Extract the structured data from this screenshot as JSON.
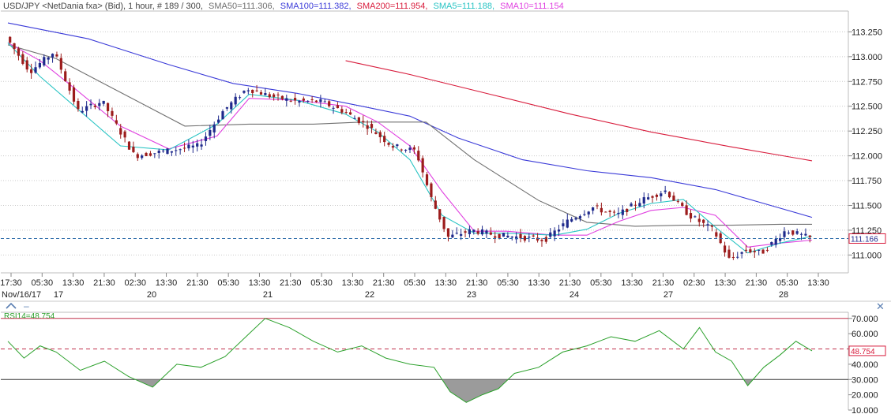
{
  "header": {
    "symbol": "USD/JPY <NetDania fxa> (Bid), 1 hour, # 189 / 300,",
    "sma50": "SMA50=111.306,",
    "sma100": "SMA100=111.382,",
    "sma200": "SMA200=111.954,",
    "sma5": "SMA5=111.188,",
    "sma10": "SMA10=111.154"
  },
  "colors": {
    "sma50": "#707070",
    "sma100": "#3a3ad8",
    "sma200": "#d81c3c",
    "sma5": "#29c4c4",
    "sma10": "#e040e0",
    "bull": "#1f2a8c",
    "bear": "#9c1c1c",
    "rsi": "#2aa02a",
    "grid": "#c9c9c9"
  },
  "price_axis": {
    "ticks": [
      "113.250",
      "113.000",
      "112.750",
      "112.500",
      "112.250",
      "112.000",
      "111.750",
      "111.500",
      "111.250",
      "111.000"
    ],
    "last_price_label": "111.166"
  },
  "time_axis": {
    "times": [
      "17:30",
      "05:30",
      "13:30",
      "21:30",
      "02:30",
      "13:30",
      "21:30",
      "05:30",
      "13:30",
      "21:30",
      "05:30",
      "13:30",
      "21:30",
      "05:30",
      "13:30",
      "21:30",
      "05:30",
      "13:30",
      "21:30",
      "05:30",
      "13:30",
      "21:30",
      "02:30",
      "13:30",
      "21:30",
      "05:30",
      "13:30"
    ],
    "dates": [
      "Nov/16/17",
      "17",
      "20",
      "21",
      "22",
      "23",
      "24",
      "27",
      "28"
    ]
  },
  "rsi": {
    "label": "RSI14=48.754",
    "value_label": "48.754",
    "ticks": [
      "70.000",
      "60.000",
      "50.000",
      "40.000",
      "30.000",
      "20.000",
      "10.000"
    ]
  },
  "chart_data": [
    {
      "type": "candlestick",
      "title": "USD/JPY <NetDania fxa> (Bid), 1 hour",
      "ylim": [
        110.82,
        113.46
      ],
      "last_price": 111.166,
      "series": [
        {
          "name": "SMA200",
          "value": 111.954,
          "x": [
            0.42,
            0.5,
            0.6,
            0.7,
            0.8,
            0.9,
            1.0
          ],
          "values": [
            112.96,
            112.82,
            112.62,
            112.42,
            112.24,
            112.09,
            111.95
          ]
        },
        {
          "name": "SMA100",
          "value": 111.382,
          "x": [
            0.0,
            0.1,
            0.2,
            0.28,
            0.36,
            0.44,
            0.5,
            0.56,
            0.64,
            0.72,
            0.8,
            0.88,
            0.94,
            1.0
          ],
          "values": [
            113.34,
            113.18,
            112.92,
            112.73,
            112.63,
            112.5,
            112.4,
            112.18,
            111.96,
            111.85,
            111.78,
            111.66,
            111.52,
            111.38
          ]
        },
        {
          "name": "SMA50",
          "value": 111.306,
          "x": [
            0.0,
            0.06,
            0.14,
            0.22,
            0.3,
            0.38,
            0.44,
            0.52,
            0.58,
            0.66,
            0.72,
            0.78,
            0.84,
            0.9,
            0.96,
            1.0
          ],
          "values": [
            113.12,
            112.98,
            112.64,
            112.3,
            112.32,
            112.32,
            112.34,
            112.34,
            111.96,
            111.55,
            111.33,
            111.29,
            111.3,
            111.3,
            111.31,
            111.31
          ]
        },
        {
          "name": "SMA10",
          "value": 111.154,
          "x": [
            0.0,
            0.04,
            0.08,
            0.14,
            0.2,
            0.26,
            0.3,
            0.36,
            0.42,
            0.46,
            0.5,
            0.54,
            0.58,
            0.62,
            0.68,
            0.72,
            0.76,
            0.8,
            0.84,
            0.88,
            0.92,
            0.96,
            1.0
          ],
          "values": [
            113.14,
            112.96,
            112.7,
            112.3,
            112.07,
            112.2,
            112.58,
            112.56,
            112.5,
            112.34,
            112.1,
            111.64,
            111.24,
            111.24,
            111.2,
            111.2,
            111.34,
            111.45,
            111.48,
            111.4,
            111.08,
            111.12,
            111.15
          ]
        },
        {
          "name": "SMA5",
          "value": 111.188,
          "x": [
            0.0,
            0.04,
            0.08,
            0.14,
            0.2,
            0.26,
            0.3,
            0.36,
            0.42,
            0.46,
            0.5,
            0.54,
            0.58,
            0.62,
            0.68,
            0.72,
            0.76,
            0.8,
            0.84,
            0.88,
            0.92,
            0.96,
            1.0
          ],
          "values": [
            113.14,
            112.8,
            112.52,
            112.1,
            112.06,
            112.32,
            112.62,
            112.56,
            112.42,
            112.24,
            111.96,
            111.4,
            111.22,
            111.22,
            111.2,
            111.26,
            111.42,
            111.52,
            111.56,
            111.28,
            111.02,
            111.12,
            111.19
          ]
        },
        {
          "name": "Price",
          "x": [
            0.0,
            0.03,
            0.06,
            0.09,
            0.12,
            0.16,
            0.2,
            0.24,
            0.27,
            0.3,
            0.33,
            0.36,
            0.39,
            0.42,
            0.45,
            0.48,
            0.51,
            0.53,
            0.55,
            0.58,
            0.61,
            0.64,
            0.67,
            0.7,
            0.73,
            0.76,
            0.79,
            0.82,
            0.85,
            0.88,
            0.9,
            0.92,
            0.94,
            0.97,
            1.0
          ],
          "values": [
            113.2,
            112.85,
            113.05,
            112.45,
            112.55,
            112.0,
            112.05,
            112.1,
            112.45,
            112.68,
            112.6,
            112.55,
            112.55,
            112.45,
            112.3,
            112.1,
            112.05,
            111.55,
            111.18,
            111.25,
            111.2,
            111.18,
            111.15,
            111.35,
            111.48,
            111.4,
            111.55,
            111.65,
            111.4,
            111.25,
            110.95,
            111.05,
            111.02,
            111.25,
            111.17
          ]
        }
      ]
    },
    {
      "type": "line",
      "title": "RSI14",
      "ylim": [
        10,
        74
      ],
      "levels": [
        70,
        50,
        30
      ],
      "x": [
        0.0,
        0.02,
        0.04,
        0.06,
        0.09,
        0.12,
        0.15,
        0.18,
        0.21,
        0.24,
        0.27,
        0.3,
        0.32,
        0.35,
        0.38,
        0.41,
        0.44,
        0.47,
        0.5,
        0.53,
        0.55,
        0.57,
        0.59,
        0.61,
        0.63,
        0.66,
        0.69,
        0.72,
        0.75,
        0.78,
        0.81,
        0.84,
        0.86,
        0.88,
        0.9,
        0.92,
        0.94,
        0.96,
        0.98,
        1.0
      ],
      "values": [
        55,
        44,
        52,
        48,
        36,
        42,
        32,
        25,
        40,
        38,
        45,
        60,
        70,
        64,
        55,
        48,
        52,
        44,
        40,
        38,
        22,
        15,
        20,
        24,
        34,
        38,
        48,
        52,
        58,
        55,
        62,
        50,
        64,
        48,
        42,
        26,
        38,
        46,
        55,
        48.754
      ]
    }
  ]
}
